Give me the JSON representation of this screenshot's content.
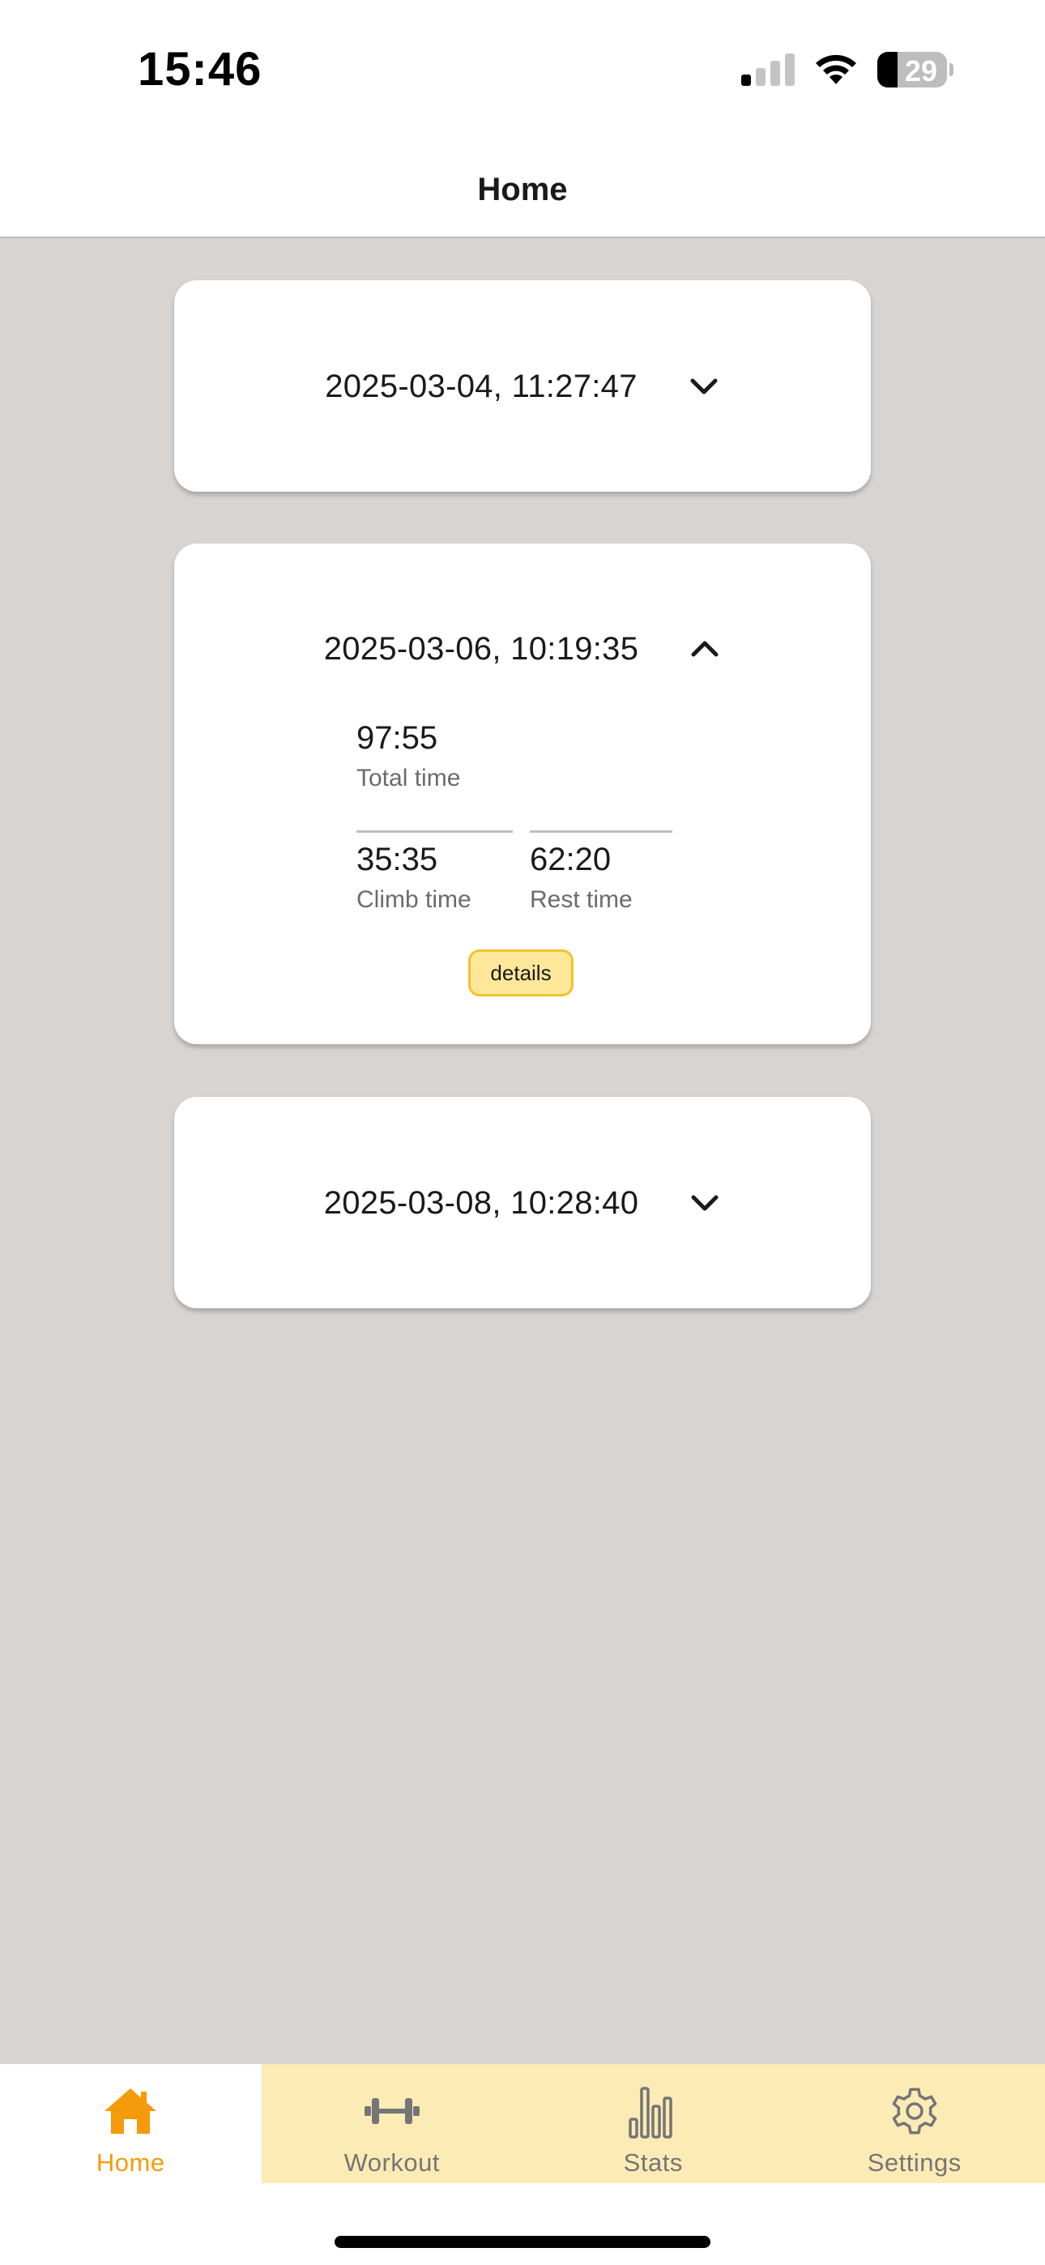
{
  "status_bar": {
    "time": "15:46",
    "battery_level": "29",
    "battery_fraction": 0.29
  },
  "header": {
    "title": "Home"
  },
  "workouts": [
    {
      "date": "2025-03-04, 11:27:47",
      "expanded": false
    },
    {
      "date": "2025-03-06, 10:19:35",
      "expanded": true,
      "total_time": "97:55",
      "total_time_label": "Total time",
      "climb_time": "35:35",
      "climb_time_label": "Climb time",
      "rest_time": "62:20",
      "rest_time_label": "Rest time",
      "details_label": "details"
    },
    {
      "date": "2025-03-08, 10:28:40",
      "expanded": false
    }
  ],
  "tab_bar": {
    "active_color": "#f59b0a",
    "inactive_color": "#757575",
    "inactive_background": "#fdebb6",
    "tabs": [
      {
        "label": "Home",
        "icon": "house-icon",
        "active": true
      },
      {
        "label": "Workout",
        "icon": "dumbbell-icon",
        "active": false
      },
      {
        "label": "Stats",
        "icon": "bar-chart-icon",
        "active": false
      },
      {
        "label": "Settings",
        "icon": "gear-icon",
        "active": false
      }
    ]
  },
  "colors": {
    "background": "#d7d4d2",
    "card": "#ffffff",
    "details_button": "#fde89a",
    "details_border": "#f2c230"
  }
}
